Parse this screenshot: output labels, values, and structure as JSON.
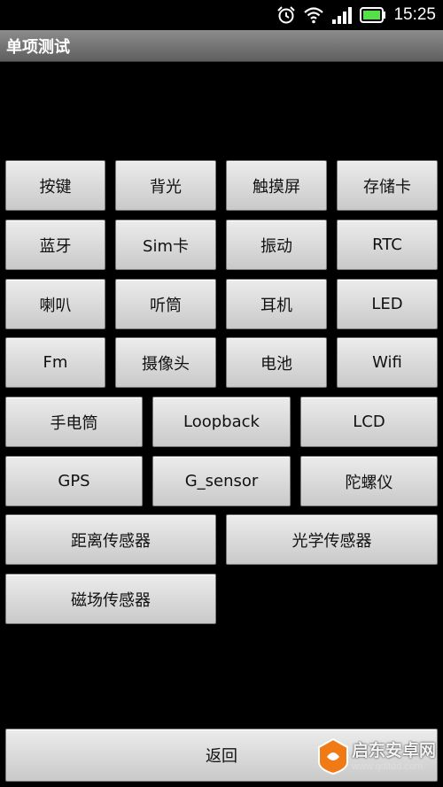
{
  "status_bar": {
    "time": "15:25",
    "icons": [
      "alarm-icon",
      "wifi-icon",
      "signal-icon",
      "battery-icon"
    ]
  },
  "title_bar": {
    "title": "单项测试"
  },
  "buttons": {
    "anjian": "按键",
    "beiguang": "背光",
    "chumoping": "触摸屏",
    "cunchuka": "存储卡",
    "lanya": "蓝牙",
    "simka": "Sim卡",
    "zhendong": "振动",
    "rtc": "RTC",
    "laba": "喇叭",
    "tingtong": "听筒",
    "erji": "耳机",
    "led": "LED",
    "fm": "Fm",
    "shexiangtou": "摄像头",
    "dianchi": "电池",
    "wifi": "Wifi",
    "shoudiantong": "手电筒",
    "loopback": "Loopback",
    "lcd": "LCD",
    "gps": "GPS",
    "gsensor": "G_sensor",
    "tuoluoyi": "陀螺仪",
    "julichuanganqi": "距离传感器",
    "guangxuechuanganqi": "光学传感器",
    "cichangchuanganqi": "磁场传感器",
    "fanhui": "返回"
  },
  "watermark": {
    "text": "启东安卓网",
    "url": "www.qdltdd.com"
  },
  "colors": {
    "background": "#000000",
    "button": "#d9d9d9",
    "title_bar": "#707070"
  }
}
